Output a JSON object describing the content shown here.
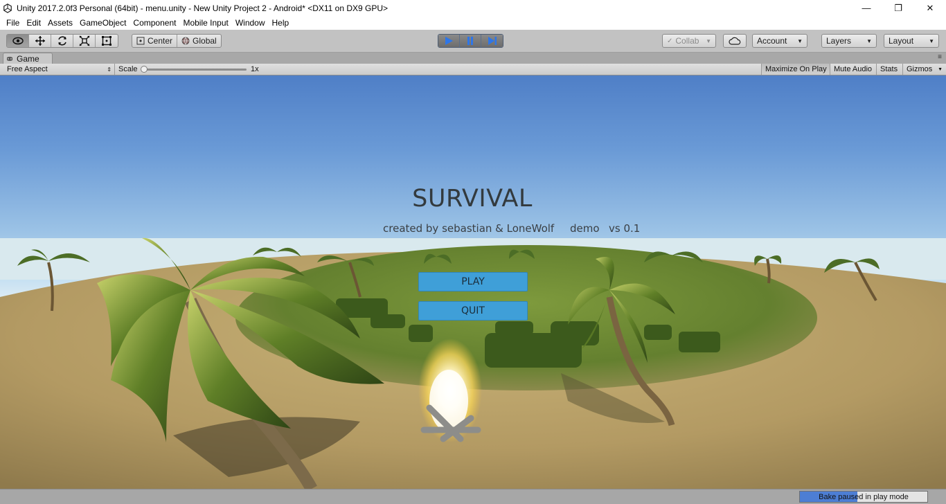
{
  "window": {
    "title": "Unity 2017.2.0f3 Personal (64bit) - menu.unity - New Unity Project 2 - Android* <DX11 on DX9 GPU>",
    "minimize": "—",
    "maximize": "❐",
    "close": "✕"
  },
  "menu": [
    "File",
    "Edit",
    "Assets",
    "GameObject",
    "Component",
    "Mobile Input",
    "Window",
    "Help"
  ],
  "toolbar": {
    "transform_tools": [
      "view-tool-icon",
      "move-tool-icon",
      "rotate-tool-icon",
      "scale-tool-icon",
      "rect-tool-icon"
    ],
    "active_tool": "view-tool-icon",
    "pivot_label": "Center",
    "space_label": "Global",
    "play_controls": [
      "play-icon",
      "pause-icon",
      "step-icon"
    ],
    "play_active": true,
    "play_accent": "#2e76e8",
    "collab_label": "Collab",
    "cloud_icon": "cloud-icon",
    "account_label": "Account",
    "layers_label": "Layers",
    "layout_label": "Layout"
  },
  "game_tab": {
    "label": "Game",
    "icon": "game-controller-icon"
  },
  "game_toolbar": {
    "aspect_label": "Free Aspect",
    "scale_label": "Scale",
    "scale_value": "1x",
    "scale_fraction": 0.0,
    "maximize_on_play": "Maximize On Play",
    "mute_audio": "Mute Audio",
    "stats": "Stats",
    "gizmos": "Gizmos"
  },
  "game_screen": {
    "title": "SURVIVAL",
    "subtitle": "created by sebastian & LoneWolf",
    "demo_label": "demo",
    "version": "vs 0.1",
    "play_button": "PLAY",
    "quit_button": "QUIT",
    "button_color": "#3f9fd8"
  },
  "status": {
    "bake_label": "Bake paused in play mode",
    "bake_progress": 0.45,
    "bake_color": "#4d7ed4"
  }
}
